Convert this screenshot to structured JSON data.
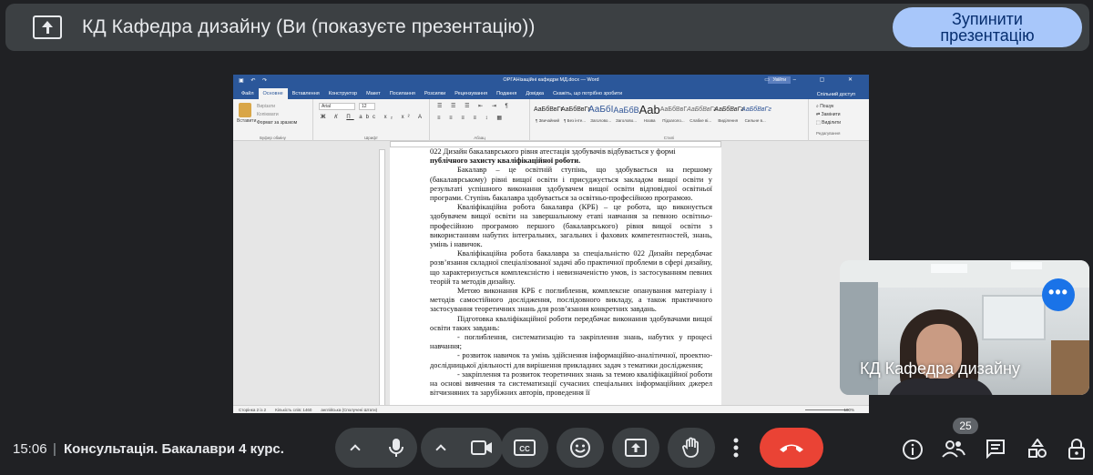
{
  "banner": {
    "title": "КД Кафедра дизайну (Ви (показуєте презентацію))",
    "stop_button": "Зупинити презентацію"
  },
  "word": {
    "title_bar": "ОРГАНізаційні кафедри МД.docx — Word",
    "sign_in": "Увійти",
    "tabs": [
      "Файл",
      "Основне",
      "Вставлення",
      "Конструктор",
      "Макет",
      "Посилання",
      "Розсилки",
      "Рецензування",
      "Подання",
      "Довідка",
      "Скажіть, що потрібно зробити"
    ],
    "share": "Спільний доступ",
    "ribbon": {
      "paste": "Вставити",
      "cut": "Вирізати",
      "copy": "Копіювати",
      "format_painter": "Формат за зразком",
      "clipboard_group": "Буфер обміну",
      "font_name": "Arial",
      "font_size": "12",
      "font_group": "Шрифт",
      "paragraph_group": "Абзац",
      "styles_group": "Стилі",
      "styles": [
        {
          "preview": "АаБбВвГг",
          "name": "¶ Звичайний"
        },
        {
          "preview": "АаБбВвГг",
          "name": "¶ Без інте..."
        },
        {
          "preview": "АаБбI",
          "name": "Заголово..."
        },
        {
          "preview": "АаБбВ",
          "name": "Заголово..."
        },
        {
          "preview": "Aab",
          "name": "Назва"
        },
        {
          "preview": "АаБбВвГ",
          "name": "Підзаголо..."
        },
        {
          "preview": "АаБбВвГг",
          "name": "Слабке ві..."
        },
        {
          "preview": "АаБбВвГг",
          "name": "Виділення"
        },
        {
          "preview": "АаБбВвГг",
          "name": "Сильне в..."
        }
      ],
      "find": "Пошук",
      "replace": "Замінити",
      "select": "Виділити",
      "editing_group": "Редагування"
    },
    "document_lines": [
      "022 Дизайн бакалаврського рівня атестація здобувачів відбувається у формі",
      "публічного захисту кваліфікаційної роботи.",
      "Бакалавр – це освітній ступінь, що здобувається на першому (бакалаврському) рівні вищої освіти і присуджується закладом вищої освіти у результаті успішного виконання здобувачем вищої освіти відповідної освітньої програми. Ступінь бакалавра здобувається за освітньо-професійною програмою.",
      "Кваліфікаційна робота бакалавра (КРБ) – це робота, що виконується здобувачем вищої освіти на завершальному етапі навчання за певною освітньо-професійною програмою першого (бакалаврського) рівня вищої освіти з використанням набутих інтегральних, загальних і фахових компетентностей, знань, умінь і навичок.",
      "Кваліфікаційна робота бакалавра за спеціальністю 022 Дизайн передбачає розв’язання складної спеціалізованої задачі або практичної проблеми в сфері дизайну, що характеризується комплексністю і невизначеністю умов, із застосуванням певних теорій та методів дизайну.",
      "Метою виконання КРБ є поглиблення, комплексне опанування матеріалу і методів самостійного дослідження, послідовного викладу, а також практичного застосування теоретичних знань для розв’язання конкретних завдань.",
      "Підготовка кваліфікаційної роботи передбачає виконання здобувачами вищої освіти таких завдань:",
      "- поглиблення, систематизацію та закріплення знань, набутих у процесі навчання;",
      "- розвиток навичок та умінь здійснення інформаційно-аналітичної, проектно-дослідницької діяльності для вирішення прикладних задач з тематики дослідження;",
      "- закріплення та розвиток теоретичних знань за темою кваліфікаційної роботи на основі вивчення та систематизації сучасних спеціальних інформаційних джерел вітчизняних та зарубіжних авторів, проведення її"
    ],
    "status": {
      "page": "Сторінка 2 із 2",
      "words": "Кількість слів: 1460",
      "language": "англійська (Сполучені Штати)",
      "zoom": "100%"
    }
  },
  "self_tile": {
    "name": "КД Кафедра дизайну"
  },
  "bottom_bar": {
    "time": "15:06",
    "separator": "|",
    "meeting_title": "Консультація. Бакалаври 4 курс.",
    "participants_count": "25"
  },
  "colors": {
    "background": "#202124",
    "banner": "#3c4043",
    "stop_button": "#a8c7fa",
    "end_call": "#ea4335",
    "more_button": "#1a73e8",
    "word_blue": "#2b579a"
  },
  "icons": {
    "present": "present-to-all-icon",
    "mic": "microphone-icon",
    "camera": "videocam-icon",
    "captions": "closed-captions-icon",
    "emoji": "emoji-icon",
    "share": "present-screen-icon",
    "hand": "raise-hand-icon",
    "more": "more-vert-icon",
    "end": "call-end-icon",
    "info": "info-icon",
    "people": "people-icon",
    "chat": "chat-icon",
    "activities": "activities-icon",
    "lock": "host-controls-lock-icon"
  }
}
